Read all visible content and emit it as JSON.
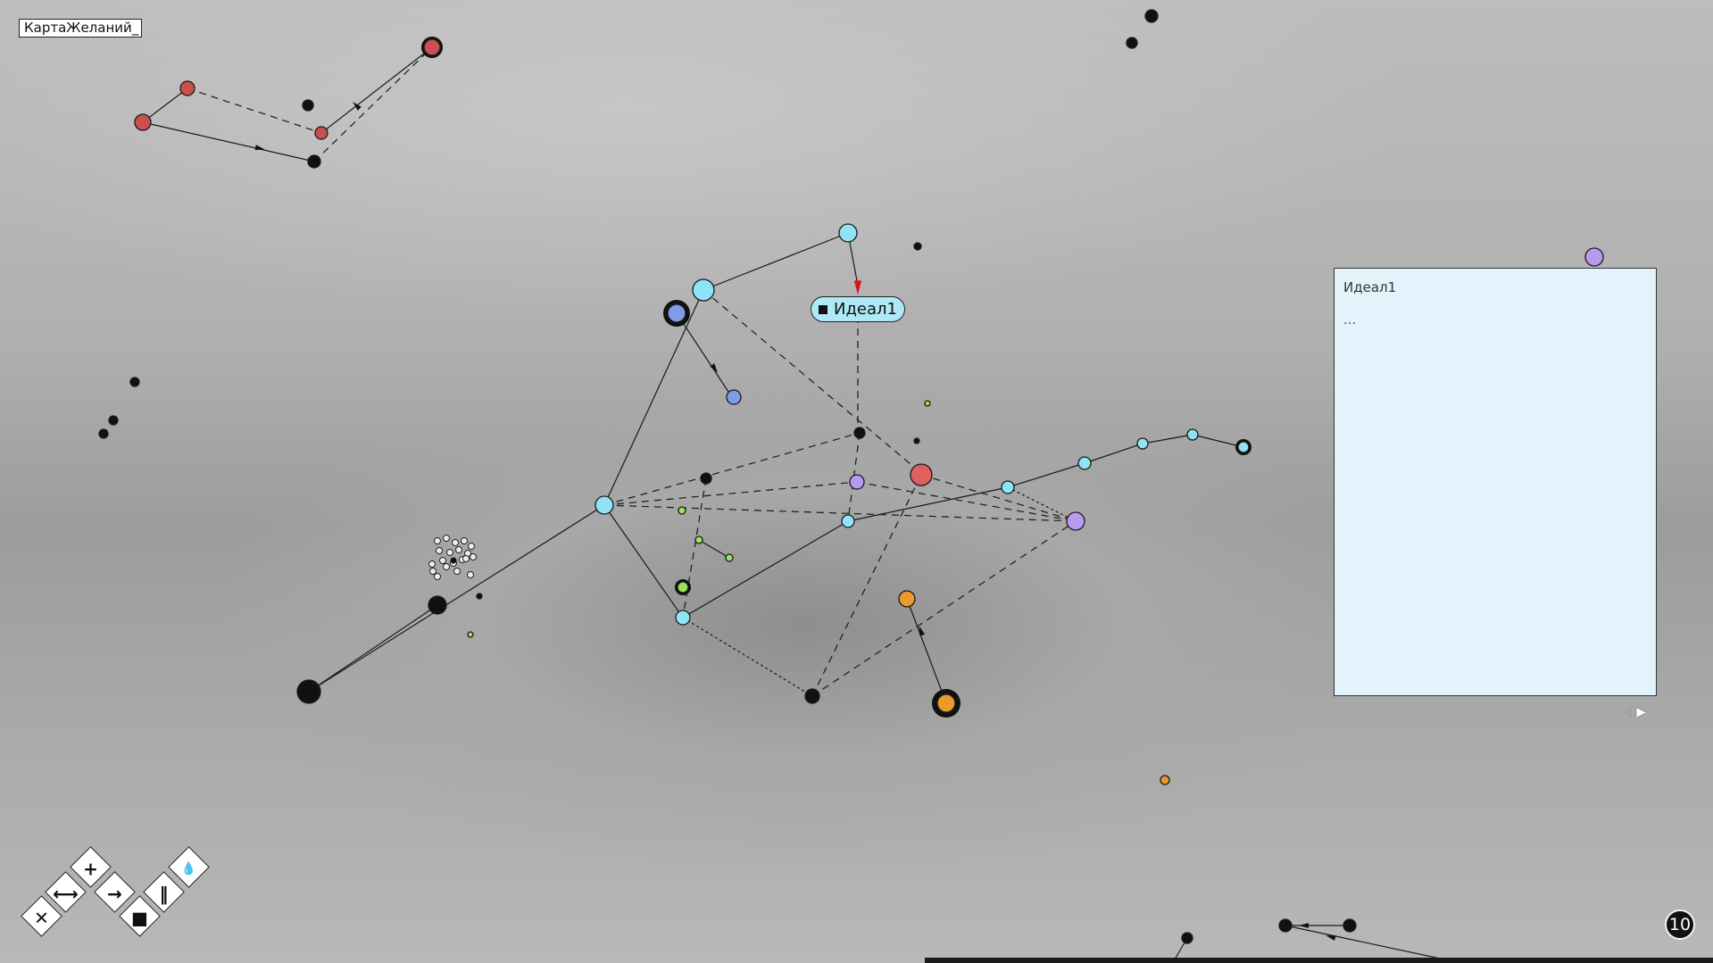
{
  "map": {
    "title": "КартаЖеланий_",
    "selected_node_label": "Идеал1"
  },
  "note_panel": {
    "title": "Идеал1",
    "body": "...",
    "prev_icon": "◁",
    "next_icon": "▶"
  },
  "counter": {
    "value": "10"
  },
  "toolbar": {
    "tools": [
      {
        "name": "delete-tool",
        "glyph": "✕"
      },
      {
        "name": "link-tool",
        "glyph": "⟷"
      },
      {
        "name": "add-tool",
        "glyph": "+"
      },
      {
        "name": "arrow-tool",
        "glyph": "→"
      },
      {
        "name": "square-tool",
        "glyph": "■"
      },
      {
        "name": "parallel-tool",
        "glyph": "‖"
      },
      {
        "name": "drop-tool",
        "glyph": "💧"
      }
    ]
  },
  "colors": {
    "cyan": "#8fe3f5",
    "red": "#e06060",
    "darkred": "#c9504f",
    "purple": "#b89af0",
    "blue": "#7f9ce8",
    "green": "#9be35a",
    "orange": "#e89a2a",
    "black": "#111111",
    "arrow_red": "#dd1111"
  }
}
